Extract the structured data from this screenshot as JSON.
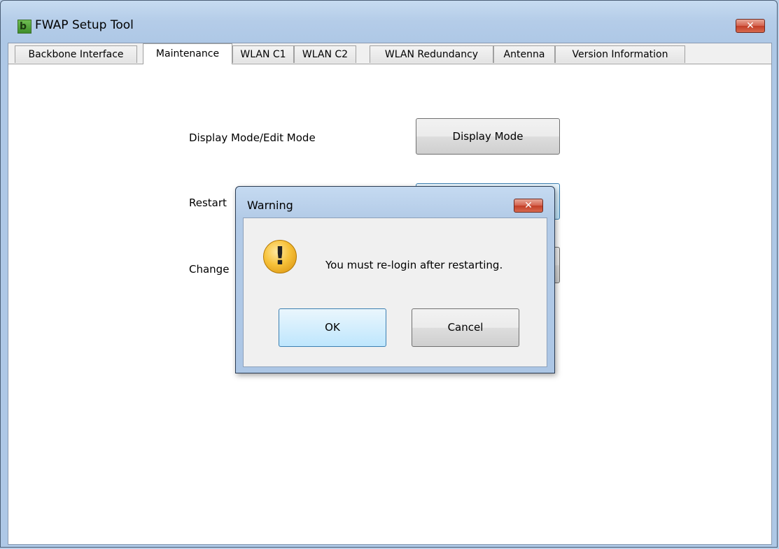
{
  "window": {
    "title": "FWAP Setup Tool",
    "close_glyph": "✕",
    "app_icon_glyph": "b"
  },
  "tabs": [
    {
      "label": "Backbone Interface"
    },
    {
      "label": "Maintenance",
      "active": true
    },
    {
      "label": "WLAN C1"
    },
    {
      "label": "WLAN C2"
    },
    {
      "label": "WLAN Redundancy"
    },
    {
      "label": "Antenna"
    },
    {
      "label": "Version Information"
    }
  ],
  "maintenance": {
    "display_mode_label": "Display Mode/Edit Mode",
    "display_mode_button": "Display Mode",
    "restart_label": "Restart",
    "change_label": "Change"
  },
  "dialog": {
    "title": "Warning",
    "close_glyph": "✕",
    "message": "You must re-login after restarting.",
    "ok_label": "OK",
    "cancel_label": "Cancel",
    "icon": "warning-icon"
  },
  "colors": {
    "window_frame": "#aec8e6",
    "close_button": "#c23d26",
    "warning_icon": "#f7c23a",
    "focus_border": "#3c7fb1"
  }
}
